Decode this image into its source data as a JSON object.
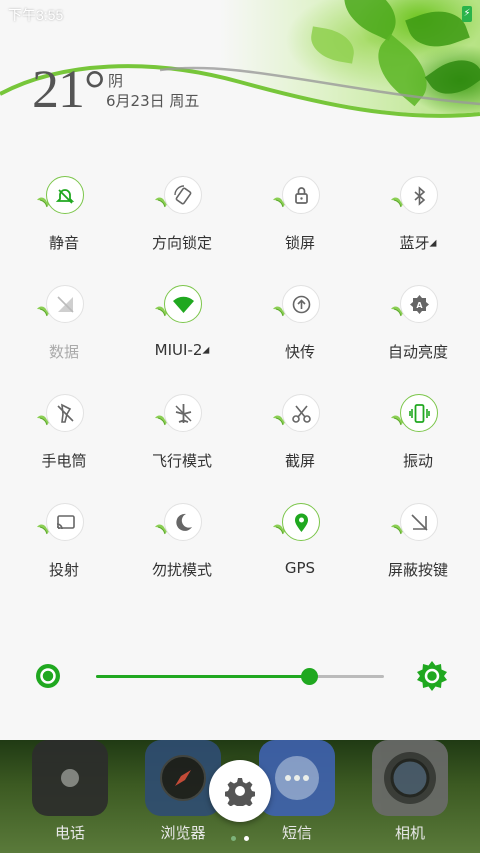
{
  "status": {
    "time": "下午3:55"
  },
  "weather": {
    "temperature": "21°",
    "condition": "阴",
    "date": "6月23日 周五"
  },
  "toggles": [
    {
      "label": "静音",
      "icon": "mute-icon",
      "on": true
    },
    {
      "label": "方向锁定",
      "icon": "rotation-lock-icon",
      "on": false
    },
    {
      "label": "锁屏",
      "icon": "lock-icon",
      "on": false
    },
    {
      "label": "蓝牙",
      "icon": "bluetooth-icon",
      "on": false,
      "expand": true
    },
    {
      "label": "数据",
      "icon": "mobile-data-icon",
      "on": false,
      "disabled": true
    },
    {
      "label": "MIUI-2",
      "icon": "wifi-icon",
      "on": true,
      "expand": true
    },
    {
      "label": "快传",
      "icon": "share-icon",
      "on": false
    },
    {
      "label": "自动亮度",
      "icon": "auto-brightness-icon",
      "on": false
    },
    {
      "label": "手电筒",
      "icon": "flashlight-icon",
      "on": false
    },
    {
      "label": "飞行模式",
      "icon": "airplane-icon",
      "on": false
    },
    {
      "label": "截屏",
      "icon": "scissors-icon",
      "on": false
    },
    {
      "label": "振动",
      "icon": "vibrate-icon",
      "on": true
    },
    {
      "label": "投射",
      "icon": "cast-icon",
      "on": false
    },
    {
      "label": "勿扰模式",
      "icon": "moon-icon",
      "on": false
    },
    {
      "label": "GPS",
      "icon": "location-icon",
      "on": true
    },
    {
      "label": "屏蔽按键",
      "icon": "block-keys-icon",
      "on": false
    }
  ],
  "brightness": {
    "level": 0.74
  },
  "dock": {
    "apps": [
      {
        "label": "电话",
        "icon": "phone-app-icon"
      },
      {
        "label": "浏览器",
        "icon": "browser-app-icon"
      },
      {
        "label": "短信",
        "icon": "messages-app-icon"
      },
      {
        "label": "相机",
        "icon": "camera-app-icon"
      }
    ],
    "settings_icon": "gear-icon",
    "page_count": 2,
    "active_page": 1
  },
  "colors": {
    "accent": "#20a820",
    "leaf": "#7cc64b"
  }
}
